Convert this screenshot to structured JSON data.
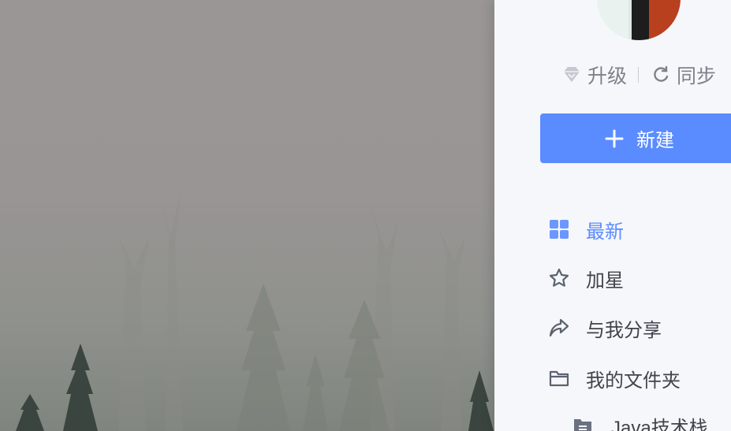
{
  "toolbar": {
    "upgrade_label": "升级",
    "sync_label": "同步"
  },
  "new_button": {
    "label": "新建"
  },
  "nav": {
    "latest": "最新",
    "starred": "加星",
    "shared_with_me": "与我分享",
    "my_folders": "我的文件夹",
    "subfolder": "Java技术栈"
  },
  "colors": {
    "accent": "#5b8cff",
    "sidebar_bg": "#f6f7fa",
    "text": "#3f444d",
    "muted": "#7d828c"
  },
  "icons": {
    "upgrade": "diamond-icon",
    "sync": "refresh-icon",
    "new": "plus-icon",
    "latest": "grid-icon",
    "starred": "star-icon",
    "shared": "share-arrow-icon",
    "folder": "folder-icon",
    "subfolder": "document-folder-icon"
  }
}
